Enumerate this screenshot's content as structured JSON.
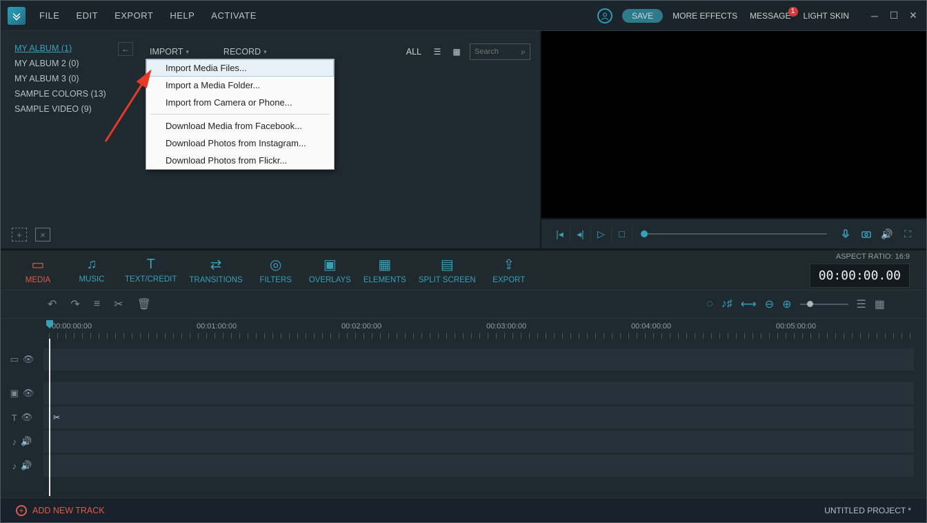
{
  "menubar": {
    "file": "FILE",
    "edit": "EDIT",
    "export": "EXPORT",
    "help": "HELP",
    "activate": "ACTIVATE"
  },
  "topbar": {
    "save": "SAVE",
    "more_effects": "MORE EFFECTS",
    "message": "MESSAGE",
    "message_badge": "1",
    "light_skin": "LIGHT SKIN"
  },
  "albums": [
    {
      "name": "MY ALBUM (1)",
      "active": true
    },
    {
      "name": "MY ALBUM 2 (0)"
    },
    {
      "name": "MY ALBUM 3 (0)"
    },
    {
      "name": "SAMPLE COLORS (13)"
    },
    {
      "name": "SAMPLE VIDEO (9)"
    }
  ],
  "media_menu": {
    "import": "IMPORT",
    "record": "RECORD",
    "all": "ALL",
    "search_placeholder": "Search"
  },
  "import_dropdown": [
    {
      "label": "Import Media Files...",
      "hover": true
    },
    {
      "label": "Import a Media Folder..."
    },
    {
      "label": "Import from Camera or Phone..."
    },
    {
      "sep": true
    },
    {
      "label": "Download Media from Facebook..."
    },
    {
      "label": "Download Photos from Instagram..."
    },
    {
      "label": "Download Photos from Flickr..."
    }
  ],
  "categories": {
    "media": "MEDIA",
    "music": "MUSIC",
    "text": "TEXT/CREDIT",
    "transitions": "TRANSITIONS",
    "filters": "FILTERS",
    "overlays": "OVERLAYS",
    "elements": "ELEMENTS",
    "split_screen": "SPLIT SCREEN",
    "export": "EXPORT"
  },
  "aspect": {
    "label": "ASPECT RATIO: 16:9",
    "timecode": "00:00:00.00"
  },
  "ruler": {
    "times": [
      "00:00:00:00",
      "00:01:00:00",
      "00:02:00:00",
      "00:03:00:00",
      "00:04:00:00",
      "00:05:00:00"
    ]
  },
  "footer": {
    "add_track": "ADD NEW TRACK",
    "project": "UNTITLED PROJECT *"
  }
}
